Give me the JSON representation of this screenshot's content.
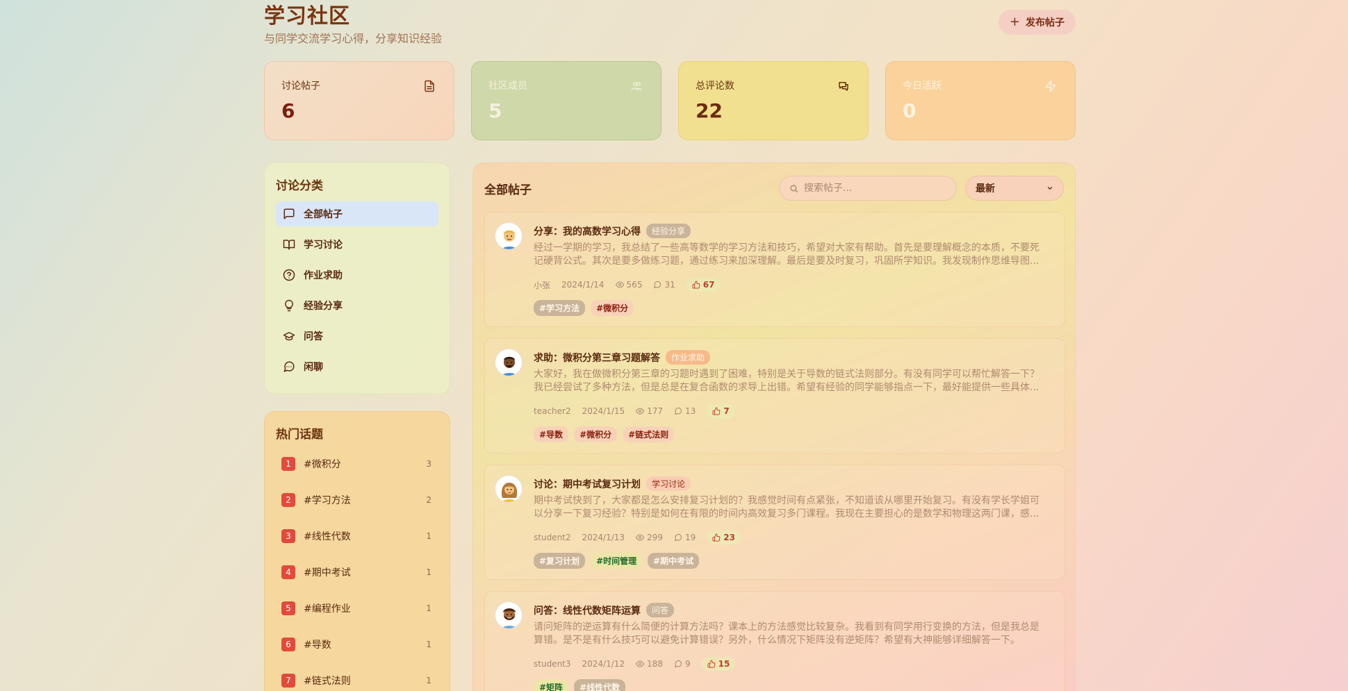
{
  "header": {
    "title": "学习社区",
    "subtitle": "与同学交流学习心得，分享知识经验",
    "new_post_label": "发布帖子",
    "new_post_icon": "plus-icon"
  },
  "stats": [
    {
      "label": "讨论帖子",
      "value": "6",
      "icon": "document-icon"
    },
    {
      "label": "社区成员",
      "value": "5",
      "icon": "users-icon"
    },
    {
      "label": "总评论数",
      "value": "22",
      "icon": "chat-icon"
    },
    {
      "label": "今日活跃",
      "value": "0",
      "icon": "lightning-icon"
    }
  ],
  "categories": {
    "title": "讨论分类",
    "items": [
      {
        "label": "全部帖子",
        "icon": "message-square-icon",
        "active": true
      },
      {
        "label": "学习讨论",
        "icon": "book-open-icon",
        "active": false
      },
      {
        "label": "作业求助",
        "icon": "help-circle-icon",
        "active": false
      },
      {
        "label": "经验分享",
        "icon": "lightbulb-icon",
        "active": false
      },
      {
        "label": "问答",
        "icon": "graduation-cap-icon",
        "active": false
      },
      {
        "label": "闲聊",
        "icon": "message-circle-icon",
        "active": false
      }
    ]
  },
  "hot_topics": {
    "title": "热门话题",
    "items": [
      {
        "rank": "1",
        "name": "#微积分",
        "count": "3"
      },
      {
        "rank": "2",
        "name": "#学习方法",
        "count": "2"
      },
      {
        "rank": "3",
        "name": "#线性代数",
        "count": "1"
      },
      {
        "rank": "4",
        "name": "#期中考试",
        "count": "1"
      },
      {
        "rank": "5",
        "name": "#编程作业",
        "count": "1"
      },
      {
        "rank": "6",
        "name": "#导数",
        "count": "1"
      },
      {
        "rank": "7",
        "name": "#链式法则",
        "count": "1"
      }
    ]
  },
  "main": {
    "title": "全部帖子",
    "search_placeholder": "搜索帖子...",
    "sort_value": "最新"
  },
  "posts": [
    {
      "title": "分享：我的高数学习心得",
      "category": "经验分享",
      "category_bg": "#c9b49a",
      "category_color": "#fff6e8",
      "excerpt": "经过一学期的学习，我总结了一些高等数学的学习方法和技巧，希望对大家有帮助。首先是要理解概念的本质，不要死记硬背公式。其次是要多做练习题，通过练习来加深理解。最后是要及时复习，巩固所学知识。我发现制作思维导图...",
      "author": "小张",
      "date": "2024/1/14",
      "views": "565",
      "comments": "31",
      "likes": "67",
      "avatar": "avatar-blond-man",
      "tags": [
        {
          "text": "#学习方法",
          "bg": "#c9b49a",
          "color": "#fff6e8"
        },
        {
          "text": "#微积分",
          "bg": "#f7d2b8",
          "color": "#8a1e10"
        }
      ]
    },
    {
      "title": "求助：微积分第三章习题解答",
      "category": "作业求助",
      "category_bg": "#f8b98a",
      "category_color": "#fff6e8",
      "excerpt": "大家好，我在做微积分第三章的习题时遇到了困难，特别是关于导数的链式法则部分。有没有同学可以帮忙解答一下？我已经尝试了多种方法，但是总是在复合函数的求导上出错。希望有经验的同学能够指点一下，最好能提供一些具体...",
      "author": "teacher2",
      "date": "2024/1/15",
      "views": "177",
      "comments": "13",
      "likes": "7",
      "avatar": "avatar-dark-man",
      "tags": [
        {
          "text": "#导数",
          "bg": "#f7d2b8",
          "color": "#8a1e10"
        },
        {
          "text": "#微积分",
          "bg": "#f7d2b8",
          "color": "#8a1e10"
        },
        {
          "text": "#链式法则",
          "bg": "#f7d2b8",
          "color": "#8a1e10"
        }
      ]
    },
    {
      "title": "讨论：期中考试复习计划",
      "category": "学习讨论",
      "category_bg": "#f8cdb4",
      "category_color": "#9a2a12",
      "excerpt": "期中考试快到了，大家都是怎么安排复习计划的？我感觉时间有点紧张，不知道该从哪里开始复习。有没有学长学姐可以分享一下复习经验？特别是如何在有限的时间内高效复习多门课程。我现在主要担心的是数学和物理这两门课，感...",
      "author": "student2",
      "date": "2024/1/13",
      "views": "299",
      "comments": "19",
      "likes": "23",
      "avatar": "avatar-woman",
      "tags": [
        {
          "text": "#复习计划",
          "bg": "#c9b49a",
          "color": "#fff6e8"
        },
        {
          "text": "#时间管理",
          "bg": "#ede6a8",
          "color": "#1f6b2a"
        },
        {
          "text": "#期中考试",
          "bg": "#c9b49a",
          "color": "#fff6e8"
        }
      ]
    },
    {
      "title": "问答：线性代数矩阵运算",
      "category": "问答",
      "category_bg": "#c9b49a",
      "category_color": "#fff6e8",
      "excerpt": "请问矩阵的逆运算有什么简便的计算方法吗？课本上的方法感觉比较复杂。我看到有同学用行变换的方法，但是我总是算错。是不是有什么技巧可以避免计算错误？另外，什么情况下矩阵没有逆矩阵？希望有大神能够详细解答一下。",
      "author": "student3",
      "date": "2024/1/12",
      "views": "188",
      "comments": "9",
      "likes": "15",
      "avatar": "avatar-bearded-man",
      "tags": [
        {
          "text": "#矩阵",
          "bg": "#ede6a8",
          "color": "#1f6b2a"
        },
        {
          "text": "#线性代数",
          "bg": "#c9b49a",
          "color": "#fff6e8"
        }
      ]
    }
  ]
}
